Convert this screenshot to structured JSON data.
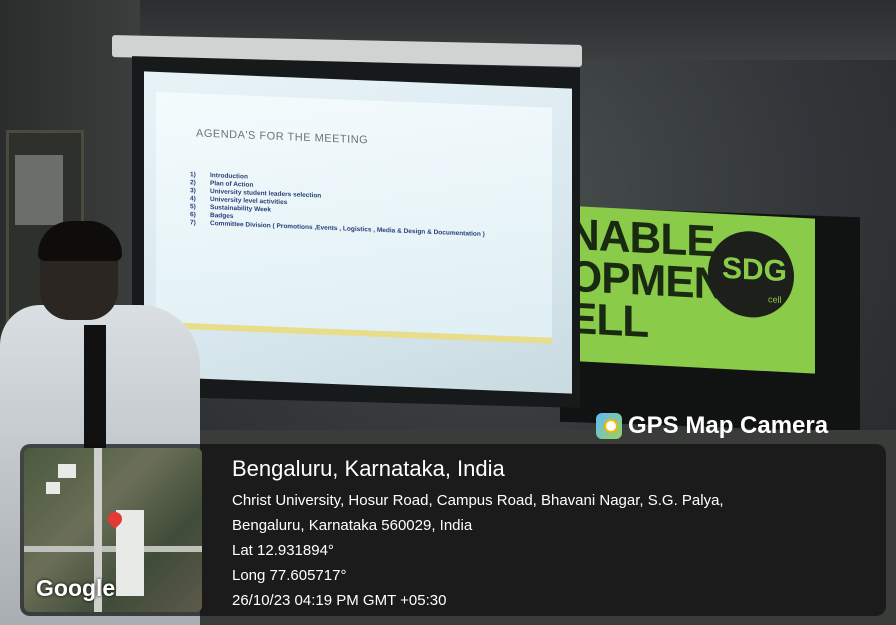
{
  "slide": {
    "title": "AGENDA'S FOR THE MEETING",
    "items": [
      {
        "num": "1)",
        "text": "Introduction"
      },
      {
        "num": "2)",
        "text": "Plan of Action"
      },
      {
        "num": "3)",
        "text": "University student leaders selection"
      },
      {
        "num": "4)",
        "text": "University level activities"
      },
      {
        "num": "5)",
        "text": "Sustainability Week"
      },
      {
        "num": "6)",
        "text": "Badges"
      },
      {
        "num": "7)",
        "text": "Committee Division ( Promotions ,Events , Logistics , Media & Design & Documentation )"
      }
    ]
  },
  "banner": {
    "line1": "NABLE",
    "line2": "OPMENT",
    "line3": "ELL",
    "logo": "SDG",
    "logo_sub": "cell"
  },
  "overlay": {
    "brand": "GPS Map Camera",
    "city": "Bengaluru, Karnataka, India",
    "address_line1": "Christ University, Hosur Road, Campus Road, Bhavani Nagar, S.G. Palya,",
    "address_line2": "Bengaluru, Karnataka 560029, India",
    "lat": "Lat 12.931894°",
    "long": "Long 77.605717°",
    "datetime": "26/10/23 04:19 PM GMT +05:30",
    "map_label": "Google"
  },
  "colors": {
    "banner_green": "#8acb4a",
    "slide_text": "#2a3f77",
    "pin_red": "#e53935"
  }
}
